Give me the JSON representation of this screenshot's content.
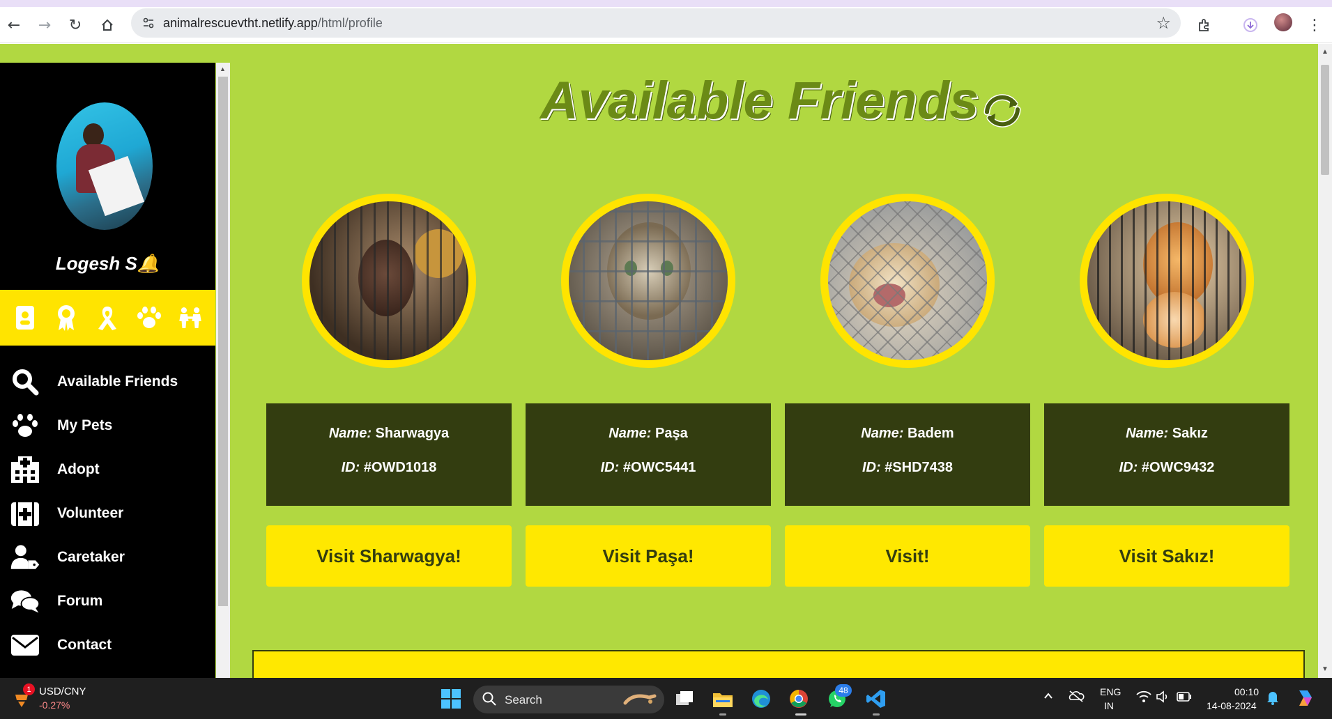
{
  "browser": {
    "url_host": "animalrescuevtht.netlify.app",
    "url_path": "/html/profile"
  },
  "sidebar": {
    "user_name": "Logesh S🔔",
    "strip_icons": [
      "id-card-icon",
      "award-icon",
      "ribbon-icon",
      "paw-icon",
      "people-icon"
    ],
    "nav": [
      {
        "label": "Available Friends",
        "icon": "search-icon"
      },
      {
        "label": "My Pets",
        "icon": "paw-icon"
      },
      {
        "label": "Adopt",
        "icon": "hospital-icon"
      },
      {
        "label": "Volunteer",
        "icon": "medical-kit-icon"
      },
      {
        "label": "Caretaker",
        "icon": "user-tag-icon"
      },
      {
        "label": "Forum",
        "icon": "comments-icon"
      },
      {
        "label": "Contact",
        "icon": "envelope-icon"
      }
    ]
  },
  "main": {
    "title": "Available Friends",
    "title_icon": "refresh-icon",
    "name_key": "Name:",
    "id_key": "ID:",
    "pets": [
      {
        "name": "Sharwagya",
        "id": "#OWD1018",
        "button": "Visit Sharwagya!",
        "photo": "puppy-in-cage"
      },
      {
        "name": "Paşa",
        "id": "#OWC5441",
        "button": "Visit Paşa!",
        "photo": "tabby-kitten-in-cage"
      },
      {
        "name": "Badem",
        "id": "#SHD7438",
        "button": "Visit!",
        "photo": "dog-behind-fence"
      },
      {
        "name": "Sakız",
        "id": "#OWC9432",
        "button": "Visit Sakız!",
        "photo": "orange-kitten-in-cage"
      }
    ]
  },
  "taskbar": {
    "stock_name": "USD/CNY",
    "stock_change": "-0.27%",
    "widget_badge": "1",
    "search_placeholder": "Search",
    "whatsapp_badge": "48",
    "lang_line1": "ENG",
    "lang_line2": "IN",
    "time": "00:10",
    "date": "14-08-2024"
  },
  "colors": {
    "page_bg": "#b1d841",
    "accent_yellow": "#ffe400",
    "card_dark": "#333d10",
    "title_green": "#6b8a16",
    "sidebar_bg": "#000000"
  }
}
